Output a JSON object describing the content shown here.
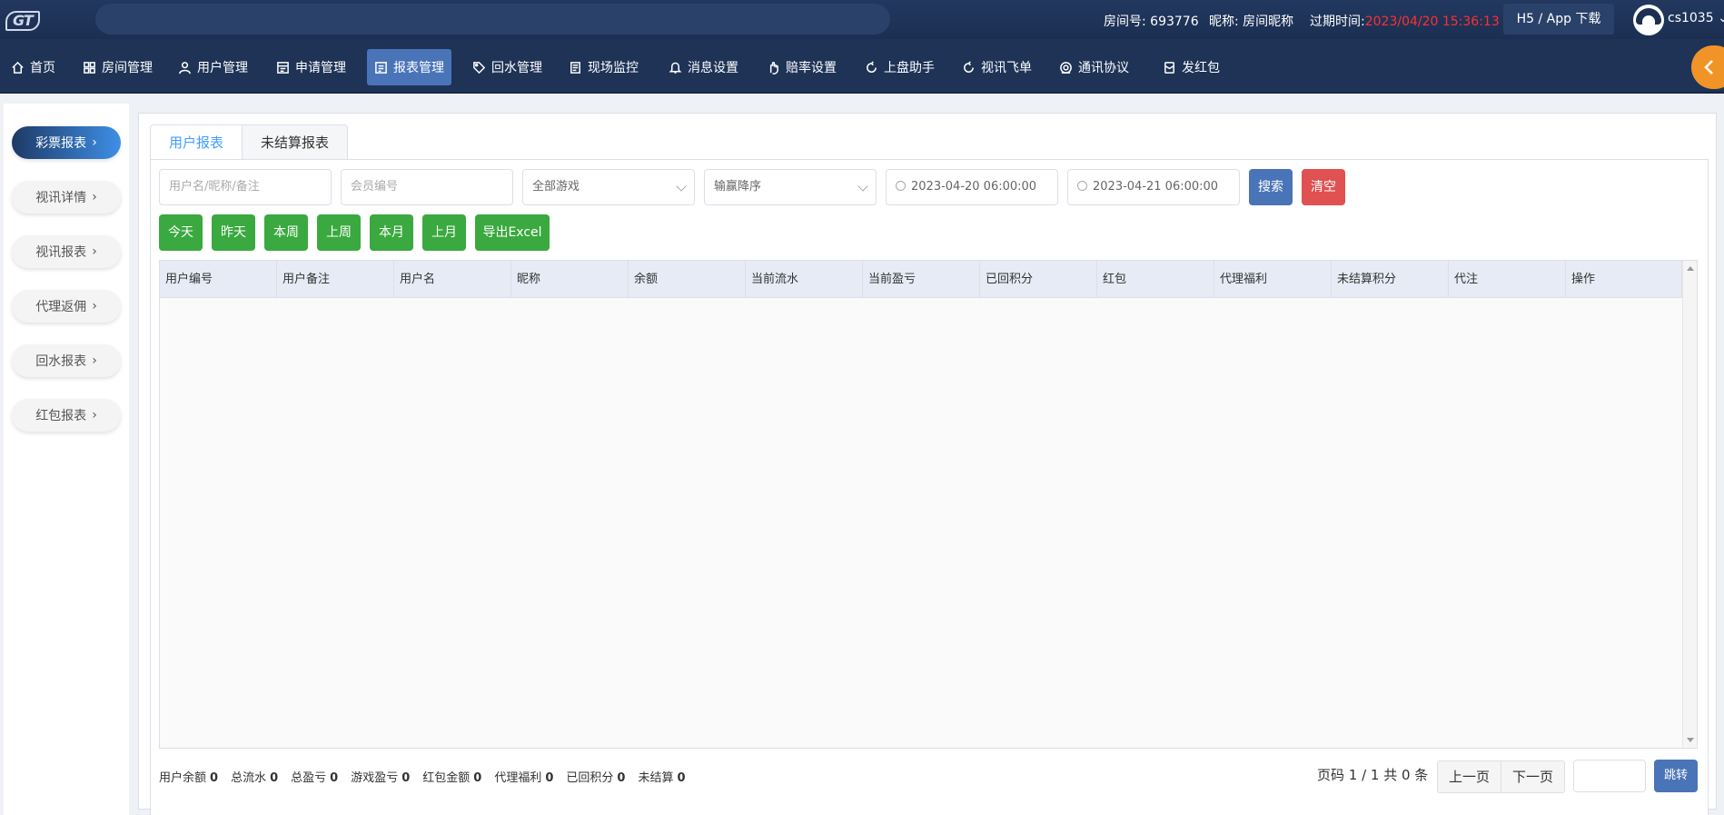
{
  "header": {
    "logo": "GT",
    "room_no_label": "房间号: 693776",
    "nickname_label": "昵称: 房间昵称",
    "expire_label": "过期时间:",
    "expire_value": "2023/04/20 15:36:13",
    "h5_button": "H5 / App 下载",
    "username": "cs1035"
  },
  "nav": {
    "items": [
      {
        "label": "首页",
        "icon": "home-icon"
      },
      {
        "label": "房间管理",
        "icon": "grid-icon"
      },
      {
        "label": "用户管理",
        "icon": "user-icon"
      },
      {
        "label": "申请管理",
        "icon": "form-icon"
      },
      {
        "label": "报表管理",
        "icon": "report-icon",
        "active": true
      },
      {
        "label": "回水管理",
        "icon": "tag-icon"
      },
      {
        "label": "现场监控",
        "icon": "monitor-icon"
      },
      {
        "label": "消息设置",
        "icon": "bell-icon"
      },
      {
        "label": "赔率设置",
        "icon": "hand-icon"
      },
      {
        "label": "上盘助手",
        "icon": "refresh-icon"
      },
      {
        "label": "视讯飞单",
        "icon": "refresh-icon"
      },
      {
        "label": "通讯协议",
        "icon": "protocol-icon"
      },
      {
        "label": "发红包",
        "icon": "redpacket-icon"
      }
    ]
  },
  "sidebar": {
    "items": [
      {
        "label": "彩票报表",
        "active": true
      },
      {
        "label": "视讯详情"
      },
      {
        "label": "视讯报表"
      },
      {
        "label": "代理返佣"
      },
      {
        "label": "回水报表"
      },
      {
        "label": "红包报表"
      }
    ]
  },
  "tabs": [
    {
      "label": "用户报表",
      "active": true
    },
    {
      "label": "未结算报表"
    }
  ],
  "filters": {
    "user_placeholder": "用户名/昵称/备注",
    "member_placeholder": "会员编号",
    "game_select": "全部游戏",
    "sort_select": "输赢降序",
    "start_date": "2023-04-20 06:00:00",
    "end_date": "2023-04-21 06:00:00",
    "search_label": "搜索",
    "clear_label": "清空"
  },
  "quick_buttons": [
    "今天",
    "昨天",
    "本周",
    "上周",
    "本月",
    "上月",
    "导出Excel"
  ],
  "table": {
    "columns": [
      "用户编号",
      "用户备注",
      "用户名",
      "昵称",
      "余额",
      "当前流水",
      "当前盈亏",
      "已回积分",
      "红包",
      "代理福利",
      "未结算积分",
      "代注",
      "操作"
    ],
    "rows": []
  },
  "summary": [
    {
      "label": "用户余额",
      "value": "0"
    },
    {
      "label": "总流水",
      "value": "0"
    },
    {
      "label": "总盈亏",
      "value": "0"
    },
    {
      "label": "游戏盈亏",
      "value": "0"
    },
    {
      "label": "红包金额",
      "value": "0"
    },
    {
      "label": "代理福利",
      "value": "0"
    },
    {
      "label": "已回积分",
      "value": "0"
    },
    {
      "label": "未结算",
      "value": "0"
    }
  ],
  "pager": {
    "text": "页码 1 / 1 共 0 条",
    "prev": "上一页",
    "next": "下一页",
    "jump": "跳转"
  },
  "colors": {
    "topbar": "#1b2f52",
    "accent_blue": "#4a74b8",
    "green": "#3aa93f",
    "red": "#e05151",
    "expire_red": "#ff3030",
    "tab_active": "#409eff"
  }
}
